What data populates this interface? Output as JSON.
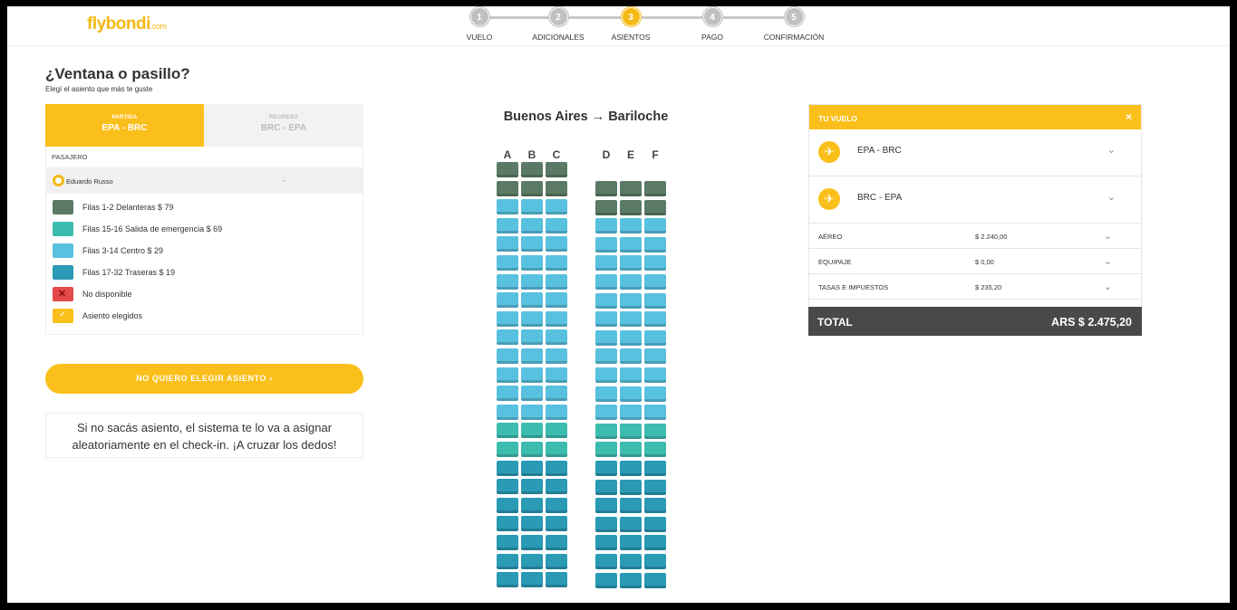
{
  "brand": {
    "logo_main": "flybondi",
    "logo_suffix": ".com",
    "accent": "#fbbf1b"
  },
  "steps": [
    {
      "num": "1",
      "label": "VUELO",
      "active": false
    },
    {
      "num": "2",
      "label": "ADICIONALES",
      "active": false
    },
    {
      "num": "3",
      "label": "ASIENTOS",
      "active": true
    },
    {
      "num": "4",
      "label": "PAGO",
      "active": false
    },
    {
      "num": "5",
      "label": "CONFIRMACIÓN",
      "active": false
    }
  ],
  "page": {
    "title": "¿Ventana o pasillo?",
    "subtitle": "Elegí el asiento que más te guste"
  },
  "tabs": {
    "outbound": {
      "small": "PARTIDA",
      "route": "EPA - BRC"
    },
    "return": {
      "small": "REGRESO",
      "route": "BRC - EPA"
    }
  },
  "passenger": {
    "header": "PASAJERO",
    "name": "Eduardo Russo",
    "seat": "-"
  },
  "legend": [
    {
      "label": "Filas 1-2 Delanteras $ 79",
      "color": "#5a7a66",
      "mark": ""
    },
    {
      "label": "Filas 15-16 Salida de emergencia $ 69",
      "color": "#3cbcae",
      "mark": ""
    },
    {
      "label": "Filas 3-14 Centro $ 29",
      "color": "#58c1df",
      "mark": ""
    },
    {
      "label": "Filas 17-32 Traseras $ 19",
      "color": "#2a9ab5",
      "mark": ""
    },
    {
      "label": "No disponible",
      "color": "#e34b4b",
      "mark": "✕"
    },
    {
      "label": "Asiento elegidos",
      "color": "#fbbf1b",
      "mark": "✓"
    }
  ],
  "no_seat_button": "NO QUIERO ELEGIR ASIENTO ›",
  "info_line1": "Si no sacás asiento, el sistema te lo va a asignar",
  "info_line2": "aleatoriamente en el check-in. ¡A cruzar los dedos!",
  "seatmap": {
    "route": "Buenos Aires → Bariloche",
    "columns_left": [
      "A",
      "B",
      "C"
    ],
    "columns_right": [
      "D",
      "E",
      "F"
    ],
    "row_types_left": [
      "front",
      "front",
      "center",
      "center",
      "center",
      "center",
      "center",
      "center",
      "center",
      "center",
      "center",
      "center",
      "center",
      "center",
      "exit",
      "exit",
      "rear",
      "rear",
      "rear",
      "rear",
      "rear",
      "rear",
      "rear"
    ],
    "row_types_right": [
      "front",
      "front",
      "center",
      "center",
      "center",
      "center",
      "center",
      "center",
      "center",
      "center",
      "center",
      "center",
      "center",
      "exit",
      "exit",
      "rear",
      "rear",
      "rear",
      "rear",
      "rear",
      "rear",
      "rear"
    ],
    "colors": {
      "front": "#5a7a66",
      "center": "#58c1df",
      "exit": "#3cbcae",
      "rear": "#2a9ab5"
    }
  },
  "your_flight": {
    "header": "TU VUELO",
    "close": "×",
    "legs": [
      {
        "route": "EPA - BRC",
        "icon": "plane-takeoff-icon"
      },
      {
        "route": "BRC - EPA",
        "icon": "plane-landing-icon"
      }
    ],
    "costs": [
      {
        "name": "AÉREO",
        "value": "$ 2.240,00"
      },
      {
        "name": "EQUIPAJE",
        "value": "$ 0,00"
      },
      {
        "name": "TASAS E IMPUESTOS",
        "value": "$ 235,20"
      }
    ],
    "total_label": "TOTAL",
    "total_value": "ARS $ 2.475,20"
  }
}
